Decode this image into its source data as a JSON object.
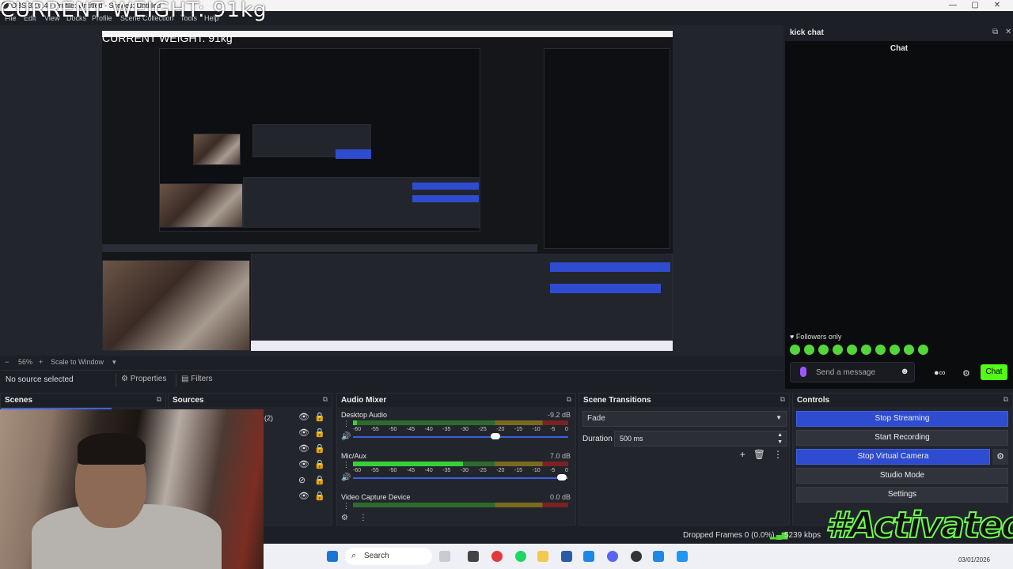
{
  "window": {
    "title": "OBS 32.0.4 - Profile: Untitled - Scenes: Untitled",
    "minimize": "—",
    "maximize": "▢",
    "close": "✕"
  },
  "menu": [
    "File",
    "Edit",
    "View",
    "Docks",
    "Profile",
    "Scene Collection",
    "Tools",
    "Help"
  ],
  "overlay": {
    "weight_text": "CURRENT WEIGHT: 91kg",
    "activated_text": "#Activated"
  },
  "preview": {
    "zoom": "56%",
    "zoom_minus": "−",
    "zoom_plus": "+",
    "scale_label": "Scale to Window"
  },
  "source_bar": {
    "no_source": "No source selected",
    "properties": "Properties",
    "filters": "Filters"
  },
  "docks": {
    "scenes": "Scenes",
    "sources": "Sources",
    "mixer": "Audio Mixer",
    "transitions": "Scene Transitions",
    "controls": "Controls"
  },
  "sources": {
    "count": "(2)"
  },
  "mixer": {
    "tracks": [
      {
        "name": "Desktop Audio",
        "db": "-9.2 dB",
        "level": 0.02,
        "volume": 0.66
      },
      {
        "name": "Mic/Aux",
        "db": "7.0 dB",
        "level": 0.51,
        "volume": 0.97
      },
      {
        "name": "Video Capture Device",
        "db": "0.0 dB",
        "level": 0.0,
        "volume": 0.5
      }
    ],
    "ticks": [
      "-60",
      "-55",
      "-50",
      "-45",
      "-40",
      "-35",
      "-30",
      "-25",
      "-20",
      "-15",
      "-10",
      "-5",
      "0"
    ]
  },
  "transitions": {
    "selected": "Fade",
    "duration_label": "Duration",
    "duration_value": "500 ms"
  },
  "controls": {
    "stop_streaming": "Stop Streaming",
    "start_recording": "Start Recording",
    "stop_virtual_camera": "Stop Virtual Camera",
    "studio_mode": "Studio Mode",
    "settings": "Settings"
  },
  "status": {
    "dropped_frames": "Dropped Frames 0 (0.0%)",
    "bitrate": "5239 kbps"
  },
  "taskbar": {
    "search": "Search",
    "date": "03/01/2026"
  },
  "chat": {
    "dock_title": "kick chat",
    "header": "Chat",
    "followers": "Followers only",
    "placeholder": "Send a message",
    "send": "Chat"
  },
  "colors": {
    "accent": "#2f4cd0",
    "kick_green": "#53fc18",
    "bg": "#1d1f26"
  }
}
